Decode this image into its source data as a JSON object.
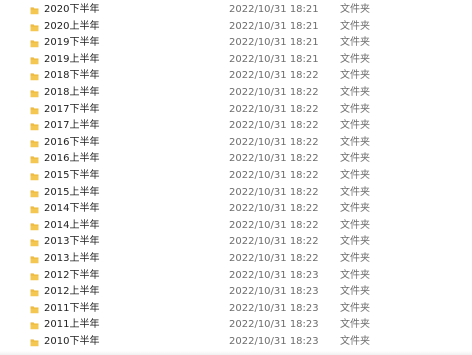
{
  "file_list": {
    "rows": [
      {
        "name": "2020下半年",
        "modified": "2022/10/31 18:21",
        "type": "文件夹",
        "icon": "folder-icon"
      },
      {
        "name": "2020上半年",
        "modified": "2022/10/31 18:21",
        "type": "文件夹",
        "icon": "folder-icon"
      },
      {
        "name": "2019下半年",
        "modified": "2022/10/31 18:21",
        "type": "文件夹",
        "icon": "folder-icon"
      },
      {
        "name": "2019上半年",
        "modified": "2022/10/31 18:21",
        "type": "文件夹",
        "icon": "folder-icon"
      },
      {
        "name": "2018下半年",
        "modified": "2022/10/31 18:22",
        "type": "文件夹",
        "icon": "folder-icon"
      },
      {
        "name": "2018上半年",
        "modified": "2022/10/31 18:22",
        "type": "文件夹",
        "icon": "folder-icon"
      },
      {
        "name": "2017下半年",
        "modified": "2022/10/31 18:22",
        "type": "文件夹",
        "icon": "folder-icon"
      },
      {
        "name": "2017上半年",
        "modified": "2022/10/31 18:22",
        "type": "文件夹",
        "icon": "folder-icon"
      },
      {
        "name": "2016下半年",
        "modified": "2022/10/31 18:22",
        "type": "文件夹",
        "icon": "folder-icon"
      },
      {
        "name": "2016上半年",
        "modified": "2022/10/31 18:22",
        "type": "文件夹",
        "icon": "folder-icon"
      },
      {
        "name": "2015下半年",
        "modified": "2022/10/31 18:22",
        "type": "文件夹",
        "icon": "folder-icon"
      },
      {
        "name": "2015上半年",
        "modified": "2022/10/31 18:22",
        "type": "文件夹",
        "icon": "folder-icon"
      },
      {
        "name": "2014下半年",
        "modified": "2022/10/31 18:22",
        "type": "文件夹",
        "icon": "folder-icon"
      },
      {
        "name": "2014上半年",
        "modified": "2022/10/31 18:22",
        "type": "文件夹",
        "icon": "folder-icon"
      },
      {
        "name": "2013下半年",
        "modified": "2022/10/31 18:22",
        "type": "文件夹",
        "icon": "folder-icon"
      },
      {
        "name": "2013上半年",
        "modified": "2022/10/31 18:22",
        "type": "文件夹",
        "icon": "folder-icon"
      },
      {
        "name": "2012下半年",
        "modified": "2022/10/31 18:23",
        "type": "文件夹",
        "icon": "folder-icon"
      },
      {
        "name": "2012上半年",
        "modified": "2022/10/31 18:23",
        "type": "文件夹",
        "icon": "folder-icon"
      },
      {
        "name": "2011下半年",
        "modified": "2022/10/31 18:23",
        "type": "文件夹",
        "icon": "folder-icon"
      },
      {
        "name": "2011上半年",
        "modified": "2022/10/31 18:23",
        "type": "文件夹",
        "icon": "folder-icon"
      },
      {
        "name": "2010下半年",
        "modified": "2022/10/31 18:23",
        "type": "文件夹",
        "icon": "folder-icon"
      }
    ]
  },
  "colors": {
    "folder_fill": "#f4c752",
    "folder_tab": "#e2a92a",
    "name_text": "#1f1f1f",
    "meta_text": "#6d6d6d"
  }
}
